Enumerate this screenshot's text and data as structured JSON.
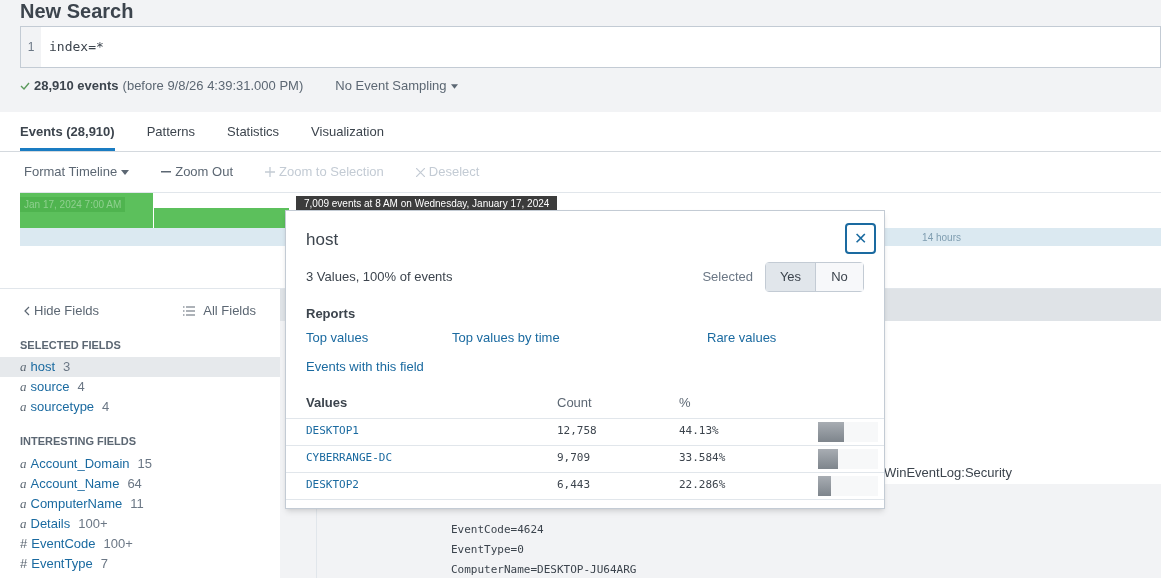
{
  "page_title": "New Search",
  "search": {
    "line_number": "1",
    "value": "index=*"
  },
  "status": {
    "count": "28,910 events",
    "range": "(before 9/8/26 4:39:31.000 PM)",
    "sampling": "No Event Sampling"
  },
  "tabs": [
    {
      "label": "Events (28,910)",
      "selected": true
    },
    {
      "label": "Patterns",
      "selected": false
    },
    {
      "label": "Statistics",
      "selected": false
    },
    {
      "label": "Visualization",
      "selected": false
    }
  ],
  "timeline_toolbar": [
    {
      "label": "Format Timeline",
      "kind": "menu",
      "disabled": false
    },
    {
      "label": "Zoom Out",
      "kind": "minus",
      "disabled": false
    },
    {
      "label": "Zoom to Selection",
      "kind": "plus",
      "disabled": true
    },
    {
      "label": "Deselect",
      "kind": "cross",
      "disabled": true
    }
  ],
  "timeline": {
    "bar_label": "Jan 17, 2024 7:00 AM",
    "tooltip": "7,009 events at 8 AM on Wednesday, January 17, 2024",
    "span_label": "14 hours"
  },
  "sidebar": {
    "hide_label": "Hide Fields",
    "all_label": "All Fields",
    "groups": [
      {
        "title": "SELECTED FIELDS",
        "fields": [
          {
            "type": "a",
            "name": "host",
            "count": "3",
            "selected": true
          },
          {
            "type": "a",
            "name": "source",
            "count": "4",
            "selected": false
          },
          {
            "type": "a",
            "name": "sourcetype",
            "count": "4",
            "selected": false
          }
        ]
      },
      {
        "title": "INTERESTING FIELDS",
        "fields": [
          {
            "type": "a",
            "name": "Account_Domain",
            "count": "15",
            "selected": false
          },
          {
            "type": "a",
            "name": "Account_Name",
            "count": "64",
            "selected": false
          },
          {
            "type": "a",
            "name": "ComputerName",
            "count": "11",
            "selected": false
          },
          {
            "type": "a",
            "name": "Details",
            "count": "100+",
            "selected": false
          },
          {
            "type": "#",
            "name": "EventCode",
            "count": "100+",
            "selected": false
          },
          {
            "type": "#",
            "name": "EventType",
            "count": "7",
            "selected": false
          }
        ]
      }
    ]
  },
  "event": {
    "sourcetype_text": "WinEventLog:Security",
    "lines": [
      "EventCode=4624",
      "EventType=0",
      "ComputerName=DESKTOP-JU64ARG"
    ]
  },
  "popup": {
    "title": "host",
    "close": "✕",
    "summary": "3 Values, 100% of events",
    "selected_label": "Selected",
    "selected_options": [
      {
        "label": "Yes",
        "selected": true
      },
      {
        "label": "No",
        "selected": false
      }
    ],
    "reports_title": "Reports",
    "reports": [
      "Top values",
      "Top values by time",
      "Rare values",
      "Events with this field"
    ],
    "columns": [
      "Values",
      "Count",
      "%"
    ],
    "rows": [
      {
        "value": "DESKTOP1",
        "count": "12,758",
        "percent": "44.13%",
        "level": 0.4413
      },
      {
        "value": "CYBERRANGE-DC",
        "count": "9,709",
        "percent": "33.584%",
        "level": 0.33584
      },
      {
        "value": "DESKTOP2",
        "count": "6,443",
        "percent": "22.286%",
        "level": 0.22286
      }
    ]
  }
}
